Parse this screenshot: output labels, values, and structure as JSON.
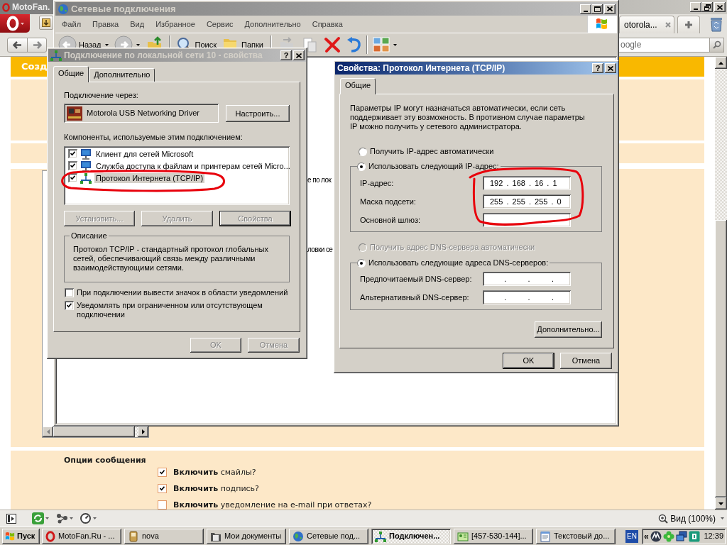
{
  "browser": {
    "title": "MotoFan.",
    "tabs": [
      {
        "label": "otorola...",
        "selected": false
      }
    ],
    "search": {
      "placeholder": "oogle"
    },
    "page": {
      "header": "Созд",
      "message_options": {
        "title": "Опции сообщения",
        "options": [
          {
            "label": "**Включить** смайлы?",
            "checked": true
          },
          {
            "label": "**Включить** подпись?",
            "checked": true
          },
          {
            "label": "**Включить** уведомление на e-mail при ответах?",
            "checked": false
          }
        ]
      }
    },
    "status_bar": {
      "zoom": "Вид (100%)"
    }
  },
  "explorer": {
    "title": "Сетевые подключения",
    "active": false,
    "menu": [
      "Файл",
      "Правка",
      "Вид",
      "Избранное",
      "Сервис",
      "Дополнительно",
      "Справка"
    ],
    "toolbar": [
      {
        "kind": "back",
        "label": "Назад",
        "disabled": true
      },
      {
        "kind": "forward",
        "disabled": true
      },
      {
        "kind": "up",
        "disabled": false
      },
      {
        "kind": "search",
        "label": "Поиск",
        "disabled": false
      },
      {
        "kind": "folders",
        "label": "Папки",
        "disabled": false
      },
      {
        "kind": "move",
        "disabled": true
      },
      {
        "kind": "copy",
        "disabled": true
      },
      {
        "kind": "delete",
        "disabled": false
      },
      {
        "kind": "undo",
        "disabled": false
      },
      {
        "kind": "views",
        "disabled": false
      }
    ],
    "fragments": [
      "е по лок",
      "ловки се"
    ]
  },
  "connection_dialog": {
    "title": "Подключение по локальной сети 10 - свойства",
    "active": false,
    "help_button": "?",
    "tabs": [
      {
        "label": "Общие",
        "selected": true
      },
      {
        "label": "Дополнительно",
        "selected": false
      }
    ],
    "connect_using": "Подключение через:",
    "adapter": "Motorola USB Networking Driver",
    "configure_button": "Настроить...",
    "components_label": "Компоненты, используемые этим подключением:",
    "components": [
      {
        "kind": "client",
        "label": "Клиент для сетей Microsoft",
        "checked": true,
        "selected": false
      },
      {
        "kind": "service",
        "label": "Служба доступа к файлам и принтерам сетей Micro...",
        "checked": true,
        "selected": false
      },
      {
        "kind": "protocol",
        "label": "Протокол Интернета (TCP/IP)",
        "checked": true,
        "selected": true
      }
    ],
    "component_buttons": [
      {
        "label": "Установить...",
        "disabled": true,
        "default": false
      },
      {
        "label": "Удалить",
        "disabled": true,
        "default": false
      },
      {
        "label": "Свойства",
        "disabled": true,
        "default": true
      }
    ],
    "description": {
      "legend": "Описание",
      "text": "Протокол TCP/IP - стандартный протокол глобальных сетей, обеспечивающий связь между различными взаимодействующими сетями."
    },
    "options": [
      {
        "label": "При подключении вывести значок в области уведомлений",
        "checked": false
      },
      {
        "label": "Уведомлять при ограниченном или отсутствующем подключении",
        "checked": true
      }
    ],
    "buttons": [
      {
        "label": "OK",
        "disabled": true,
        "default": false
      },
      {
        "label": "Отмена",
        "disabled": true,
        "default": false
      }
    ]
  },
  "tcpip_dialog": {
    "title": "Свойства: Протокол Интернета (TCP/IP)",
    "active": true,
    "help_button": "?",
    "tabs": [
      {
        "label": "Общие",
        "selected": true
      }
    ],
    "intro": "Параметры IP могут назначаться автоматически, если сеть поддерживает эту возможность. В противном случае параметры IP можно получить у сетевого администратора.",
    "ip_mode": [
      {
        "label": "Получить IP-адрес автоматически",
        "selected": false,
        "disabled": false
      },
      {
        "label": "Использовать следующий IP-адрес:",
        "selected": true,
        "disabled": false
      }
    ],
    "ip_fields": [
      {
        "label": "IP-адрес:",
        "value": "192 . 168 . 16 . 1"
      },
      {
        "label": "Маска подсети:",
        "value": "255 . 255 . 255 . 0"
      },
      {
        "label": "Основной шлюз:"
      }
    ],
    "dns_mode": [
      {
        "label": "Получить адрес DNS-сервера автоматически",
        "selected": false,
        "disabled": true
      },
      {
        "label": "Использовать следующие адреса DNS-серверов:",
        "selected": true,
        "disabled": false
      }
    ],
    "dns_fields": [
      {
        "label": "Предпочитаемый DNS-сервер:",
        "value": "    .      .      ."
      },
      {
        "label": "Альтернативный DNS-сервер:",
        "value": "    .      .      ."
      }
    ],
    "advanced_button": "Дополнительно...",
    "buttons": [
      {
        "label": "OK",
        "disabled": false,
        "default": true
      },
      {
        "label": "Отмена",
        "disabled": false,
        "default": false
      }
    ]
  },
  "annotations": [
    {
      "kind": "ink_loop"
    },
    {
      "kind": "ink_loop"
    }
  ],
  "taskbar": {
    "start": "Пуск",
    "tasks": [
      {
        "kind": "opera",
        "label": "MotoFan.Ru - ...",
        "selected": false
      },
      {
        "kind": "drive",
        "label": "nova",
        "selected": false
      },
      {
        "kind": "documents",
        "label": "Мои документы",
        "selected": false
      },
      {
        "kind": "globe",
        "label": "Сетевые под...",
        "selected": false
      },
      {
        "kind": "connection",
        "label": "Подключен...",
        "selected": true
      },
      {
        "kind": "contact",
        "label": "[457-530-144]...",
        "selected": false
      },
      {
        "kind": "notepad",
        "label": "Текстовый до...",
        "selected": false
      }
    ],
    "language": "EN",
    "tray_expand": "«",
    "clock": "12:39"
  }
}
